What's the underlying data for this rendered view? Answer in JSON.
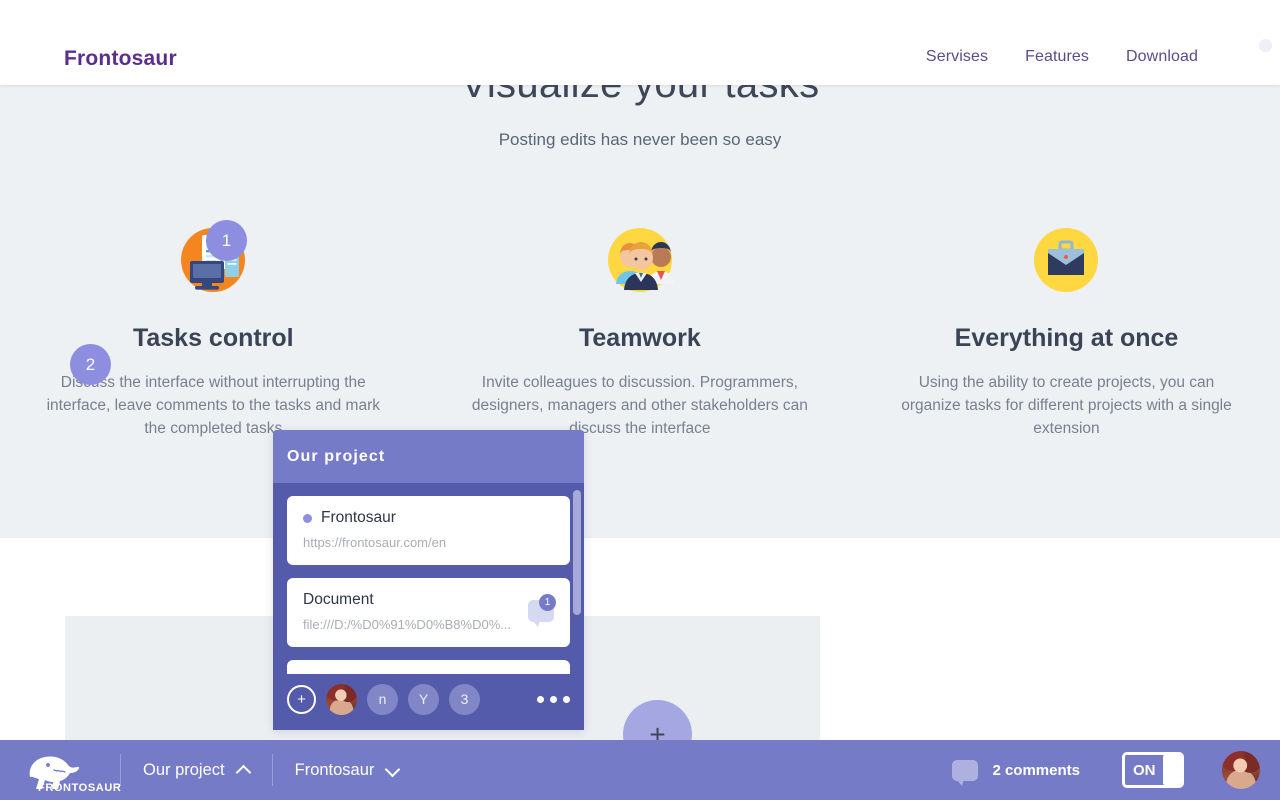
{
  "header": {
    "brand": "Frontosaur",
    "nav": [
      {
        "label": "Servises"
      },
      {
        "label": "Features"
      },
      {
        "label": "Download"
      }
    ]
  },
  "hero": {
    "title": "Visualize your tasks",
    "subtitle": "Posting edits has never been so easy"
  },
  "features": [
    {
      "icon": "computer-document-icon",
      "title": "Tasks control",
      "text": "Discuss the interface without interrupting the interface, leave comments to the tasks and mark the completed tasks"
    },
    {
      "icon": "team-people-icon",
      "title": "Teamwork",
      "text": "Invite colleagues to discussion. Programmers, designers, managers and other stakeholders can discuss the interface"
    },
    {
      "icon": "briefcase-icon",
      "title": "Everything at once",
      "text": "Using the ability to create projects, you can organize tasks for different projects with a single extension"
    }
  ],
  "annotations": [
    {
      "number": "1"
    },
    {
      "number": "2"
    }
  ],
  "panel": {
    "title": "Our project",
    "items": [
      {
        "name": "Frontosaur",
        "url": "https://frontosaur.com/en",
        "comments": ""
      },
      {
        "name": "Document",
        "url": "file:///D:/%D0%91%D0%B8%D0%...",
        "comments": "1"
      }
    ],
    "members": [
      {
        "type": "add",
        "label": "+"
      },
      {
        "type": "photo",
        "label": ""
      },
      {
        "type": "initial",
        "label": "n"
      },
      {
        "type": "initial",
        "label": "Y"
      },
      {
        "type": "initial",
        "label": "3"
      }
    ],
    "more_icon": "more-dots-icon"
  },
  "fab": {
    "label": "+",
    "icon": "plus-icon"
  },
  "toolbar": {
    "logo_word": "FRONTOSAUR",
    "logo_icon": "dinosaur-icon",
    "project_selector": "Our project",
    "project_chevron": "chevron-up-icon",
    "page_selector": "Frontosaur",
    "page_chevron": "chevron-down-icon",
    "comments_icon": "comment-bubble-icon",
    "comments_label": "2 comments",
    "toggle_label": "ON",
    "avatar": "user-avatar"
  },
  "colors": {
    "brand_purple": "#5b2d8e",
    "accent_purple": "#767bc8",
    "panel_body": "#545bab",
    "badge_purple": "#8e8ee0",
    "page_gray": "#eef1f4"
  }
}
